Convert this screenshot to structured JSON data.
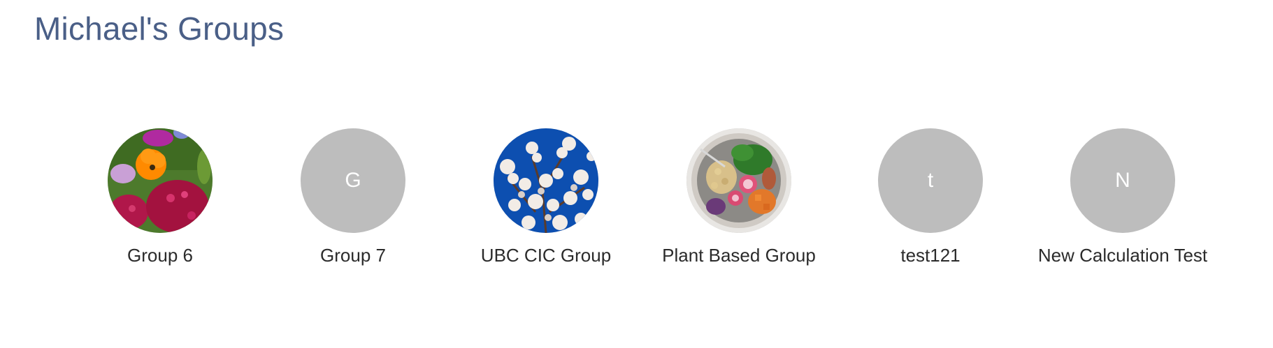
{
  "page": {
    "title": "Michael's Groups"
  },
  "groups": [
    {
      "name": "Group 6",
      "avatar_type": "image",
      "image_subject": "flowers-photo",
      "letter": ""
    },
    {
      "name": "Group 7",
      "avatar_type": "letter",
      "image_subject": "",
      "letter": "G"
    },
    {
      "name": "UBC CIC Group",
      "avatar_type": "image",
      "image_subject": "cherry-blossom-photo",
      "letter": ""
    },
    {
      "name": "Plant Based Group",
      "avatar_type": "image",
      "image_subject": "salad-bowl-photo",
      "letter": ""
    },
    {
      "name": "test121",
      "avatar_type": "letter",
      "image_subject": "",
      "letter": "t"
    },
    {
      "name": "New Calculation Test",
      "avatar_type": "letter",
      "image_subject": "",
      "letter": "N"
    }
  ],
  "colors": {
    "title": "#4a5f87",
    "placeholder_avatar": "#bdbdbd",
    "group_name": "#2b2b2b"
  }
}
